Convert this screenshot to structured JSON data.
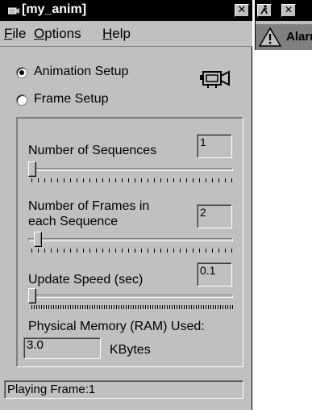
{
  "window": {
    "title": "[my_anim]",
    "close_label": "✕"
  },
  "menu": {
    "items": [
      {
        "accel": "F",
        "rest": "ile"
      },
      {
        "accel": "O",
        "rest": "ptions"
      },
      {
        "accel": "H",
        "rest": "elp"
      }
    ]
  },
  "mode": {
    "animation_setup": "Animation Setup",
    "frame_setup": "Frame Setup",
    "selected": "Animation Setup"
  },
  "settings": {
    "sequences": {
      "label": "Number of Sequences",
      "value": "1",
      "slider_fraction": 0.0
    },
    "frames": {
      "label_line1": "Number of Frames in",
      "label_line2": "each Sequence",
      "value": "2",
      "slider_fraction": 0.03
    },
    "speed": {
      "label": "Update Speed (sec)",
      "value": "0.1",
      "slider_fraction": 0.0
    },
    "memory": {
      "label": "Physical Memory (RAM) Used:",
      "value": "3.0",
      "unit": "KBytes"
    }
  },
  "status": {
    "text": "Playing Frame:1"
  },
  "second_window": {
    "close_label": "✕",
    "alarm_text": "Alarm"
  },
  "colors": {
    "face": "#c0c0c0",
    "titlebar": "#000000"
  },
  "icons": [
    "app-icon",
    "camera-icon",
    "running-man-icon",
    "warning-icon"
  ]
}
